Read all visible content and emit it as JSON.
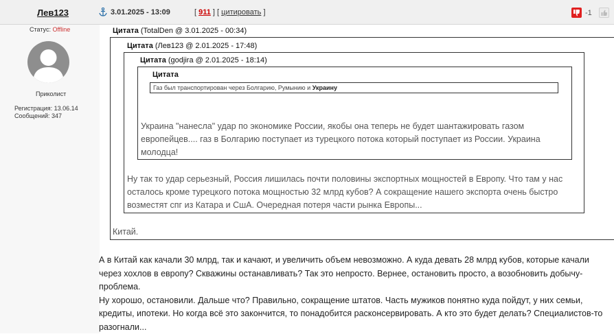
{
  "post": {
    "author": "Лев123",
    "date": "3.01.2025 - 13:09",
    "post_number": "911",
    "quote_link": "цитировать",
    "rating": "-1"
  },
  "profile": {
    "status_label": "Статус:",
    "status_value": "Offline",
    "rank": "Приколист",
    "registration": "Регистрация: 13.06.14",
    "messages": "Сообщений: 347"
  },
  "quotes": [
    {
      "label": "Цитата",
      "meta": "(TotalDen @ 3.01.2025 - 00:34)",
      "text": "Китай."
    },
    {
      "label": "Цитата",
      "meta": "(Лев123 @ 2.01.2025 - 17:48)",
      "text": "Ну так то удар серьезный, Россия лишилась почти половины экспортных мощностей в Европу. Что там у нас осталось кроме турецкого потока мощностью 32 млрд кубов? А сокращение нашего экспорта очень быстро возместят спг из Катара и СшА. Очередная потеря части рынка Европы..."
    },
    {
      "label": "Цитата",
      "meta": "(godjira @ 2.01.2025 - 18:14)",
      "text": "Украина \"нанесла\" удар по экономике России, якобы она теперь не будет шантажировать газом европейцев.... газ в Болгарию поступает из турецкого потока который поступает из России. Украина молодца!"
    },
    {
      "label": "Цитата",
      "text_plain": "Газ был транспортирован через Болгарию, Румынию и",
      "text_bold": "Украину"
    }
  ],
  "reply": [
    "А в Китай как качали 30 млрд, так и качают, и увеличить объем невозможно. А куда девать 28 млрд кубов, которые качали через хохлов в европу? Скважины останавливать? Так это непросто. Вернее, остановить просто, а возобновить добычу- проблема.",
    "Ну хорошо, остановили. Дальше что? Правильно, сокращение штатов. Часть мужиков понятно куда пойдут, у них семьи, кредиты, ипотеки. Но когда всё это закончится, то понадобится расконсервировать. А кто это будет делать? Специалистов-то разогнали..."
  ],
  "icons": {
    "anchor": "anchor-icon",
    "rating_down": "thumbs-down-icon",
    "rating_up": "thumbs-up-icon",
    "avatar": "user-avatar-icon"
  },
  "colors": {
    "header_bg": "#f0f0f0",
    "offline": "#cc3333",
    "post_number": "#cc0000",
    "rating_down_bg": "#e02020",
    "anchor": "#2a6fa8"
  }
}
